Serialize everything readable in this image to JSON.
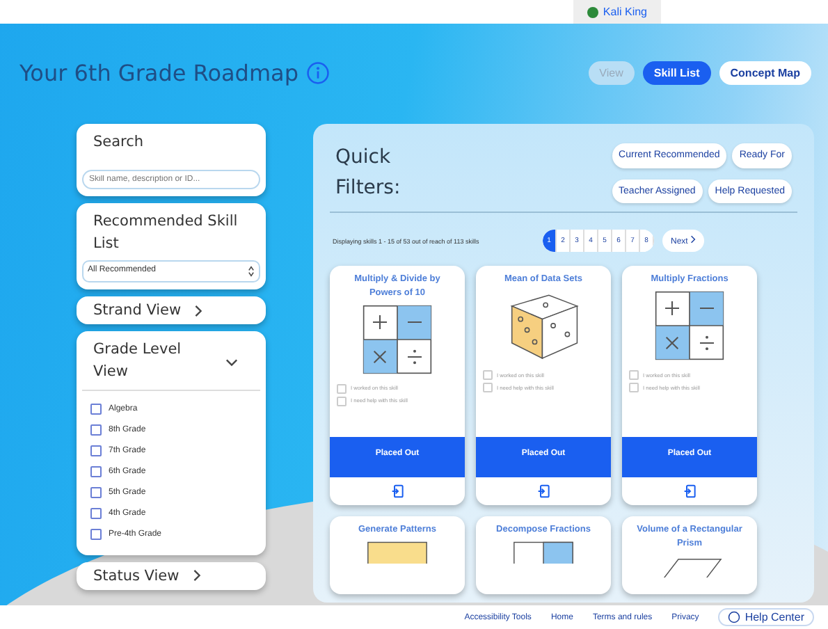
{
  "top_bar": {
    "user": "Kali King"
  },
  "header": {
    "title": "Your 6th Grade Roadmap",
    "view_label": "View",
    "view_buttons": [
      {
        "label": "Skill List",
        "selected": true
      },
      {
        "label": "Concept Map",
        "selected": false
      }
    ]
  },
  "sidebar": {
    "search": {
      "heading": "Search",
      "placeholder": "Skill name, description or ID..."
    },
    "recommended": {
      "heading": "Recommended Skill List",
      "select_value": "All Recommended"
    },
    "strand_view": {
      "label": "Strand View"
    },
    "grade_level": {
      "label": "Grade Level View",
      "expanded": true,
      "items": [
        {
          "label": "Algebra",
          "checked": false
        },
        {
          "label": "8th Grade",
          "checked": false
        },
        {
          "label": "7th Grade",
          "checked": false
        },
        {
          "label": "6th Grade",
          "checked": false
        },
        {
          "label": "5th Grade",
          "checked": false
        },
        {
          "label": "4th Grade",
          "checked": false
        },
        {
          "label": "Pre-4th Grade",
          "checked": false
        }
      ]
    },
    "status_view": {
      "label": "Status View"
    }
  },
  "filters": {
    "title": "Quick Filters:",
    "buttons": [
      "Current Recommended",
      "Ready For",
      "Teacher Assigned",
      "Help Requested"
    ]
  },
  "pagination": {
    "summary": "Displaying skills 1 - 15 of 53 out of reach of 113 skills",
    "pages": [
      {
        "label": "1",
        "selected": true
      },
      {
        "label": "2",
        "selected": false
      },
      {
        "label": "3",
        "selected": false
      },
      {
        "label": "4",
        "selected": false
      },
      {
        "label": "5",
        "selected": false
      },
      {
        "label": "6",
        "selected": false
      },
      {
        "label": "7",
        "selected": false
      },
      {
        "label": "8",
        "selected": false
      }
    ],
    "next": "Next"
  },
  "cards": [
    {
      "title": "Multiply & Divide by Powers of 10",
      "kind": "operations",
      "checkboxes": [
        {
          "label": "I worked on this skill",
          "checked": false
        },
        {
          "label": "I need help with this skill",
          "checked": false
        }
      ],
      "status": "Placed Out"
    },
    {
      "title": "Mean of Data Sets",
      "kind": "cube",
      "checkboxes": [
        {
          "label": "I worked on this skill",
          "checked": false
        },
        {
          "label": "I need help with this skill",
          "checked": false
        }
      ],
      "status": "Placed Out"
    },
    {
      "title": "Multiply Fractions",
      "kind": "operations",
      "checkboxes": [
        {
          "label": "I worked on this skill",
          "checked": false
        },
        {
          "label": "I need help with this skill",
          "checked": false
        }
      ],
      "status": "Placed Out"
    },
    {
      "title": "Generate Patterns",
      "kind": "pattern"
    },
    {
      "title": "Decompose Fractions",
      "kind": "fraction"
    },
    {
      "title": "Volume of a Rectangular Prism",
      "kind": "prism"
    }
  ],
  "footer": {
    "links": [
      "Accessibility Tools",
      "Home",
      "Terms and rules",
      "Privacy"
    ],
    "help": "Help Center"
  }
}
